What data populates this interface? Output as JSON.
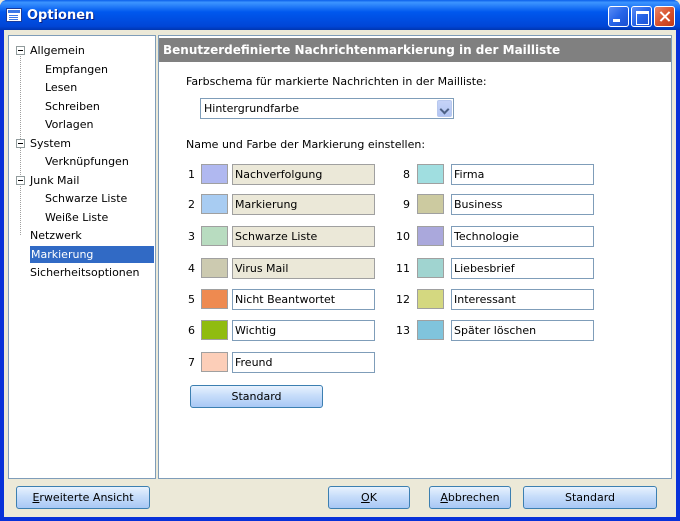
{
  "window": {
    "title": "Optionen"
  },
  "tree": {
    "items": [
      {
        "label": "Allgemein",
        "level": 0,
        "expander": true
      },
      {
        "label": "Empfangen",
        "level": 1
      },
      {
        "label": "Lesen",
        "level": 1
      },
      {
        "label": "Schreiben",
        "level": 1
      },
      {
        "label": "Vorlagen",
        "level": 1
      },
      {
        "label": "System",
        "level": 0,
        "expander": true
      },
      {
        "label": "Verknüpfungen",
        "level": 1
      },
      {
        "label": "Junk Mail",
        "level": 0,
        "expander": true
      },
      {
        "label": "Schwarze Liste",
        "level": 1
      },
      {
        "label": "Weiße Liste",
        "level": 1
      },
      {
        "label": "Netzwerk",
        "level": 0
      },
      {
        "label": "Markierung",
        "level": 0,
        "selected": true
      },
      {
        "label": "Sicherheitsoptionen",
        "level": 0
      }
    ]
  },
  "panel": {
    "header": "Benutzerdefinierte Nachrichtenmarkierung in der Mailliste",
    "scheme_label": "Farbschema für markierte Nachrichten in der Mailliste:",
    "scheme_value": "Hintergrundfarbe",
    "marks_label": "Name und Farbe der Markierung einstellen:",
    "marks_left": [
      {
        "num": "1",
        "color": "#B0B8F0",
        "name": "Nachverfolgung",
        "readonly": true
      },
      {
        "num": "2",
        "color": "#A8CCF2",
        "name": "Markierung",
        "readonly": true
      },
      {
        "num": "3",
        "color": "#B8DCC0",
        "name": "Schwarze Liste",
        "readonly": true
      },
      {
        "num": "4",
        "color": "#CCCAB0",
        "name": "Virus Mail",
        "readonly": true
      },
      {
        "num": "5",
        "color": "#EE8A50",
        "name": "Nicht Beantwortet",
        "readonly": false
      },
      {
        "num": "6",
        "color": "#90BC10",
        "name": "Wichtig",
        "readonly": false
      },
      {
        "num": "7",
        "color": "#FCCEB8",
        "name": "Freund",
        "readonly": false
      }
    ],
    "marks_right": [
      {
        "num": "8",
        "color": "#A0DEE0",
        "name": "Firma",
        "readonly": false
      },
      {
        "num": "9",
        "color": "#CCCAA0",
        "name": "Business",
        "readonly": false
      },
      {
        "num": "10",
        "color": "#AAA8DC",
        "name": "Technologie",
        "readonly": false
      },
      {
        "num": "11",
        "color": "#A0D4D0",
        "name": "Liebesbrief",
        "readonly": false
      },
      {
        "num": "12",
        "color": "#D4D880",
        "name": "Interessant",
        "readonly": false
      },
      {
        "num": "13",
        "color": "#80C4DC",
        "name": "Später löschen",
        "readonly": false
      }
    ],
    "standard_button": "Standard"
  },
  "footer": {
    "advanced_view": {
      "pre": "",
      "accel": "E",
      "post": "rweiterte Ansicht"
    },
    "ok": {
      "pre": "",
      "accel": "O",
      "post": "K"
    },
    "cancel": {
      "pre": "",
      "accel": "A",
      "post": "bbrechen"
    },
    "standard": "Standard"
  }
}
